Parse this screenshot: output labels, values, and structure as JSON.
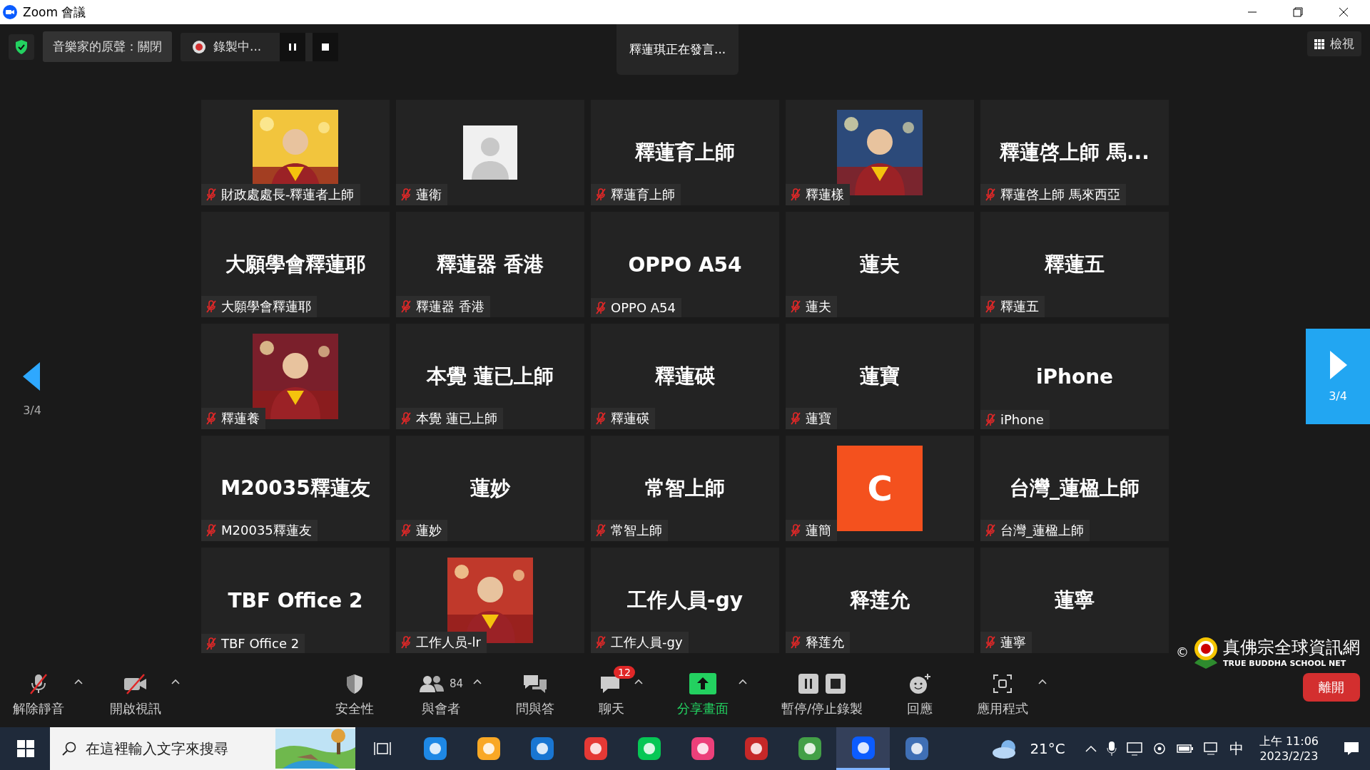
{
  "window": {
    "title": "Zoom 會議"
  },
  "top_bar": {
    "music_mode": "音樂家的原聲：關閉",
    "recording": "錄製中...",
    "speaker": "釋蓮琪正在發言...",
    "view": "檢視"
  },
  "tiles": [
    {
      "kind": "picture",
      "label": "財政處處長-釋蓮者上師",
      "muted": true
    },
    {
      "kind": "avatar",
      "label": "蓮衛",
      "muted": true
    },
    {
      "kind": "name",
      "display": "釋蓮育上師",
      "label": "釋蓮育上師",
      "muted": true
    },
    {
      "kind": "picture",
      "label": "釋蓮樣",
      "muted": true
    },
    {
      "kind": "name",
      "display": "釋蓮啓上師 馬...",
      "label": "釋蓮啓上師 馬來西亞",
      "muted": true
    },
    {
      "kind": "name",
      "display": "大願學會釋蓮耶",
      "label": "大願學會釋蓮耶",
      "muted": true
    },
    {
      "kind": "name",
      "display": "釋蓮器 香港",
      "label": "釋蓮器 香港",
      "muted": true
    },
    {
      "kind": "name",
      "display": "OPPO A54",
      "label": "OPPO A54",
      "muted": true
    },
    {
      "kind": "name",
      "display": "蓮夫",
      "label": "蓮夫",
      "muted": true
    },
    {
      "kind": "name",
      "display": "釋蓮五",
      "label": "釋蓮五",
      "muted": true
    },
    {
      "kind": "picture",
      "label": "釋蓮養",
      "muted": true
    },
    {
      "kind": "name",
      "display": "本覺  蓮已上師",
      "label": "本覺  蓮已上師",
      "muted": true
    },
    {
      "kind": "name",
      "display": "釋蓮碤",
      "label": "釋蓮碤",
      "muted": true
    },
    {
      "kind": "name",
      "display": "蓮寶",
      "label": "蓮寶",
      "muted": true
    },
    {
      "kind": "name",
      "display": "iPhone",
      "label": "iPhone",
      "muted": true
    },
    {
      "kind": "name",
      "display": "M20035釋蓮友",
      "label": "M20035釋蓮友",
      "muted": true
    },
    {
      "kind": "name",
      "display": "蓮妙",
      "label": "蓮妙",
      "muted": true
    },
    {
      "kind": "name",
      "display": "常智上師",
      "label": "常智上師",
      "muted": true
    },
    {
      "kind": "letter",
      "display": "C",
      "color": "#f4511e",
      "label": "蓮簡",
      "muted": true
    },
    {
      "kind": "name",
      "display": "台灣_蓮楹上師",
      "label": "台灣_蓮楹上師",
      "muted": true
    },
    {
      "kind": "name",
      "display": "TBF Office 2",
      "label": "TBF Office 2",
      "muted": true
    },
    {
      "kind": "picture",
      "label": "工作人员-lr",
      "muted": true
    },
    {
      "kind": "name",
      "display": "工作人員-gy",
      "label": "工作人員-gy",
      "muted": true
    },
    {
      "kind": "name",
      "display": "释莲允",
      "label": "释莲允",
      "muted": true
    },
    {
      "kind": "name",
      "display": "蓮寧",
      "label": "蓮寧",
      "muted": true
    }
  ],
  "pager": {
    "left": "3/4",
    "right": "3/4"
  },
  "toolbar": [
    {
      "kind": "mic",
      "label": "解除靜音",
      "caret": true
    },
    {
      "kind": "video",
      "label": "開啟視訊",
      "caret": true
    },
    {
      "kind": "security",
      "label": "安全性",
      "caret": false
    },
    {
      "kind": "participants",
      "label": "與會者",
      "count": "84",
      "caret": true
    },
    {
      "kind": "qa",
      "label": "問與答",
      "caret": false
    },
    {
      "kind": "chat",
      "label": "聊天",
      "badge": "12",
      "caret": true
    },
    {
      "kind": "share",
      "label": "分享畫面",
      "caret": true
    },
    {
      "kind": "record",
      "label": "暫停/停止錄製",
      "caret": false
    },
    {
      "kind": "reactions",
      "label": "回應",
      "caret": false
    },
    {
      "kind": "apps",
      "label": "應用程式",
      "caret": true
    }
  ],
  "logo": {
    "copyright": "©",
    "title": "真佛宗全球資訊網",
    "subtitle": "TRUE BUDDHA SCHOOL NET"
  },
  "leave_button": "離開",
  "taskbar": {
    "search_placeholder": "在這裡輸入文字來搜尋",
    "temperature": "21°C",
    "ime": "中",
    "time": "上午 11:06",
    "date": "2023/2/23"
  }
}
